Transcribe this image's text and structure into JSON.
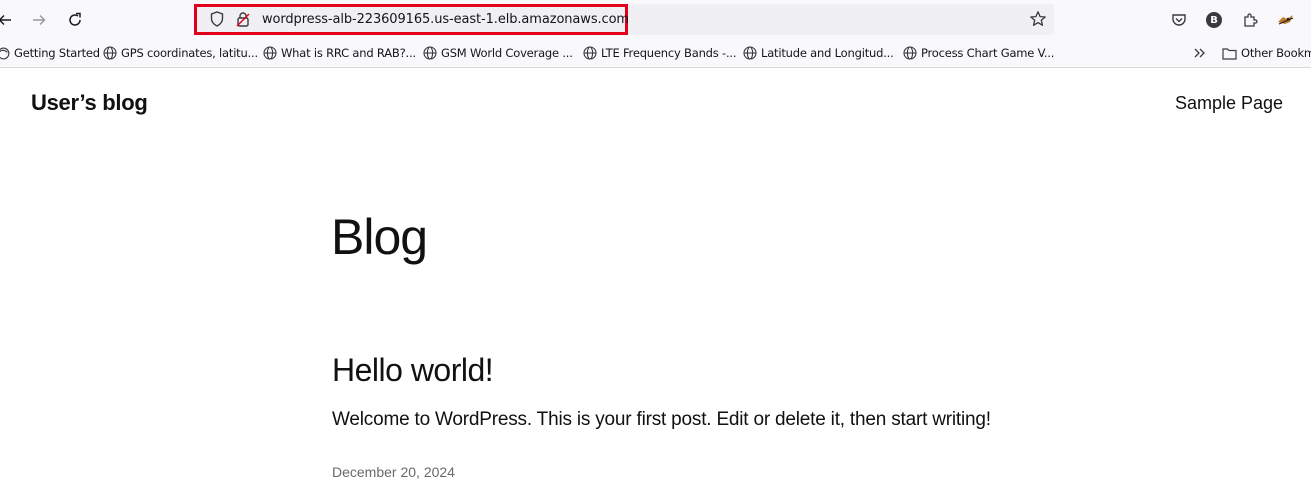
{
  "browser": {
    "url": "wordpress-alb-223609165.us-east-1.elb.amazonaws.com",
    "profile_initial": "B",
    "icons": [
      "back-arrow-icon",
      "forward-arrow-icon",
      "reload-icon",
      "shield-icon",
      "lock-icon",
      "star-icon",
      "pocket-icon",
      "extensions-icon",
      "fox-icon",
      "chevrons-icon",
      "folder-icon"
    ],
    "highlight_color": "#e3001b"
  },
  "bookmarks": {
    "items": [
      "Getting Started",
      "GPS coordinates, latitu...",
      "What is RRC and RAB?...",
      "GSM World Coverage ...",
      "LTE Frequency Bands -...",
      "Latitude and Longitud...",
      "Process Chart Game V..."
    ],
    "other": "Other Bookm"
  },
  "site": {
    "title": "User’s blog",
    "nav": [
      "Sample Page"
    ]
  },
  "page": {
    "heading": "Blog",
    "post": {
      "title": "Hello world!",
      "excerpt": "Welcome to WordPress. This is your first post. Edit or delete it, then start writing!",
      "date": "December 20, 2024"
    }
  }
}
